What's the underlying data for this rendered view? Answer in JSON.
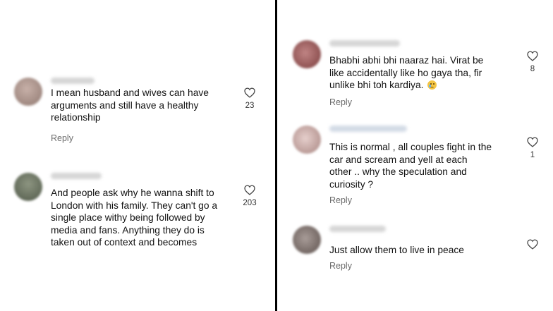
{
  "left": {
    "comments": [
      {
        "text": "I mean husband and wives can have\narguments and still have a healthy\nrelationship",
        "reply_label": "Reply",
        "likes": "23",
        "avatar_color": "#a58e86"
      },
      {
        "text": "And people ask why he wanna shift to\nLondon with his family. They can't go a\nsingle place withy being followed by\nmedia and fans. Anything they do is\ntaken out of context and becomes",
        "reply_label": "",
        "likes": "203",
        "avatar_color": "#6f7766"
      }
    ]
  },
  "right": {
    "comments": [
      {
        "text_line1": "Bhabhi abhi bhi naaraz hai. Virat be",
        "text_line2": "like accidentally like ho gaya tha, fir",
        "text_line3": "unlike bhi toh kardiya.",
        "emoji_icon": "crying-face-icon",
        "reply_label": "Reply",
        "likes": "8",
        "avatar_color": "#9c5a5a"
      },
      {
        "text": "This is normal , all couples fight in the\ncar and scream and yell at each\nother .. why the speculation and\ncuriosity ?",
        "reply_label": "Reply",
        "likes": "1",
        "avatar_color": "#c9a9a6"
      },
      {
        "text": "Just allow them to live in peace",
        "reply_label": "Reply",
        "likes": "",
        "avatar_color": "#7b6e6a"
      }
    ]
  },
  "colors": {
    "divider": "#000000",
    "reply_text": "#6b6b6b"
  }
}
